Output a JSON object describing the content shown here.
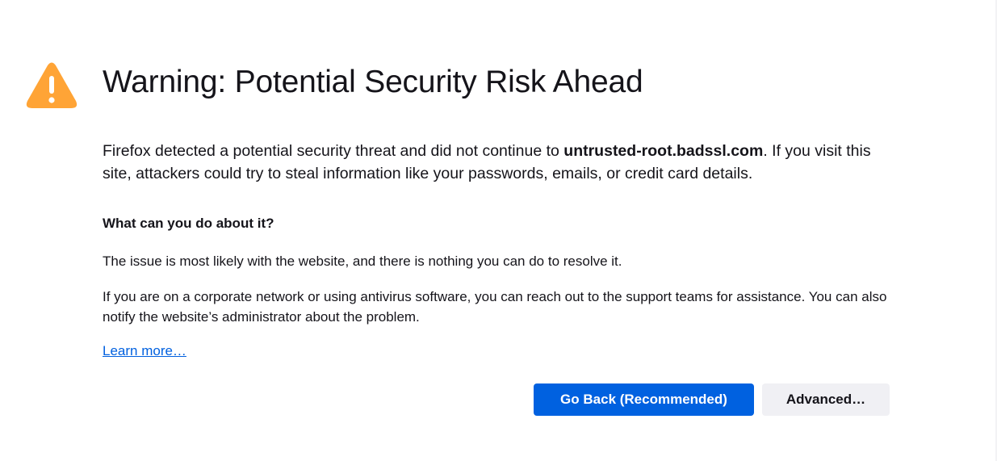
{
  "error_page": {
    "title": "Warning: Potential Security Risk Ahead",
    "intro_before": "Firefox detected a potential security threat and did not continue to ",
    "intro_host": "untrusted-root.badssl.com",
    "intro_after": ". If you visit this site, attackers could try to steal information like your passwords, emails, or credit card details.",
    "what_heading": "What can you do about it?",
    "para1": "The issue is most likely with the website, and there is nothing you can do to resolve it.",
    "para2": "If you are on a corporate network or using antivirus software, you can reach out to the support teams for assistance. You can also notify the website’s administrator about the problem.",
    "learn_more": "Learn more…"
  },
  "buttons": {
    "go_back": "Go Back (Recommended)",
    "advanced": "Advanced…"
  },
  "icons": {
    "warning": "warning-icon"
  },
  "colors": {
    "warning_fill": "#ffa436",
    "primary_button": "#0061e0",
    "link": "#0060df",
    "secondary_button": "#f0f0f4",
    "text": "#15141a"
  }
}
